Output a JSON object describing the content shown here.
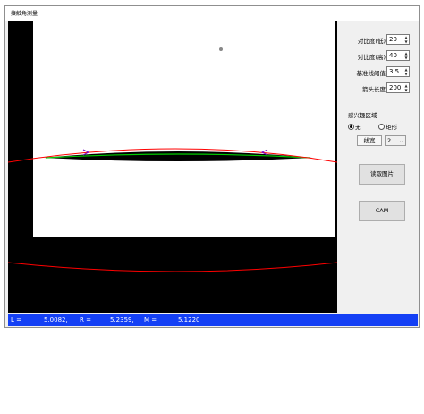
{
  "window": {
    "title": "接触角测量"
  },
  "controls": {
    "contrast_low_label": "对比度(低)",
    "contrast_low_value": "20",
    "contrast_high_label": "对比度(高)",
    "contrast_high_value": "40",
    "baseline_threshold_label": "基准线阈值",
    "baseline_threshold_value": "3.5",
    "arrow_length_label": "箭头长度",
    "arrow_length_value": "200",
    "roi_title": "感兴趣区域",
    "roi_options": [
      "无",
      "矩形"
    ],
    "roi_selected": "无",
    "line_width_label": "线宽",
    "line_width_value": "2",
    "read_image_button": "读取图片",
    "cam_button": "CAM"
  },
  "status": {
    "l_label": "L =",
    "l_value": "5.0082,",
    "r_label": "R =",
    "r_value": "5.2359,",
    "m_label": "M =",
    "m_value": "5.1220"
  },
  "colors": {
    "contour": "#ff0000",
    "fit_line": "#00cc00",
    "marker": "#7a00cc",
    "status_bar": "#1440f5"
  }
}
